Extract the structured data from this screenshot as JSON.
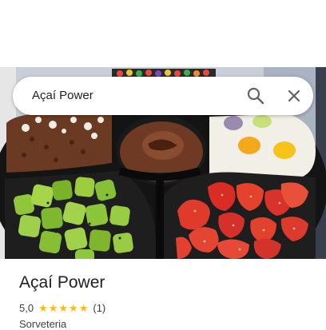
{
  "search": {
    "query": "Açaí Power"
  },
  "icons": {
    "search": "search-icon",
    "close": "close-icon",
    "star": "star-icon"
  },
  "place": {
    "name": "Açaí Power",
    "rating": "5,0",
    "stars": 5,
    "reviews": "(1)",
    "category": "Sorveteria"
  },
  "colors": {
    "star": "#fbbc04",
    "text": "#202124",
    "muted": "#3c4043"
  }
}
